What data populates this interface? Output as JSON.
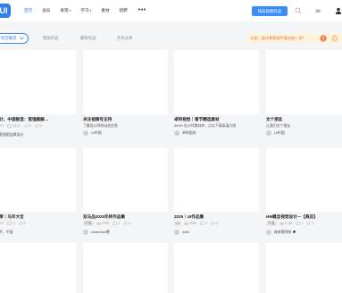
{
  "header": {
    "logo": "UI",
    "nav": [
      {
        "label": "首页",
        "active": true,
        "caret": false
      },
      {
        "label": "会员",
        "active": false,
        "caret": false
      },
      {
        "label": "发现",
        "active": false,
        "caret": true
      },
      {
        "label": "学习",
        "active": false,
        "caret": true
      },
      {
        "label": "素材",
        "active": false,
        "caret": false
      },
      {
        "label": "招聘",
        "active": false,
        "caret": false
      }
    ],
    "more": "•••",
    "upload_label": "快去投稿作品"
  },
  "filter": {
    "sort_label": "综合推荐",
    "tabs": [
      "帮助作品",
      "最新作品",
      "佳作分享"
    ],
    "notice": "公告：设计师再创平面元的一次！"
  },
  "cards": [
    {
      "title": "…设计，中国智造：宽强图解…",
      "sub": "",
      "stats": [
        "4097",
        "5171",
        "0",
        "0"
      ],
      "author": "宽强图品牌设计",
      "badge": false
    },
    {
      "title": "关注视频号支持",
      "sub": "了解设计师的动态信息",
      "stats": [],
      "author": "UI中国",
      "badge": false
    },
    {
      "title": "卓特视觉｜春节精选素材",
      "sub": "5000+设计师素材库，点击下载高清大图",
      "stats": [],
      "author": "卓特视觉",
      "badge": false
    },
    {
      "title": "文个朋友",
      "sub": "让我们交个朋友",
      "stats": [],
      "author": "UI中国",
      "badge": false
    },
    {
      "title": "…分享｜马年大吉",
      "sub": "",
      "stats": [
        "4047",
        "0",
        "0"
      ],
      "author": "平…平面",
      "badge": false
    },
    {
      "title": "双马品2025年终作品集",
      "sub": "",
      "stats": [
        "平面",
        "4795",
        "1",
        "4"
      ],
      "author": "chanchan雪",
      "badge": false
    },
    {
      "title": "2025｜UI作品集",
      "sub": "",
      "stats": [
        "UI",
        "4066",
        "1",
        "4"
      ],
      "author": "Ariel",
      "badge": false
    },
    {
      "title": "HM概念视觉设计—【商店】",
      "sub": "",
      "stats": [
        "平面",
        "1748",
        "1",
        "1"
      ],
      "author": "继承需你呀",
      "badge": true
    }
  ]
}
